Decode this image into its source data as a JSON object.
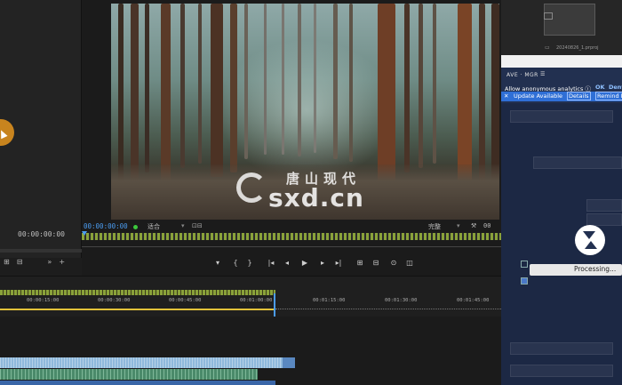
{
  "left_panel": {
    "timecode": "00:00:00:00"
  },
  "program_monitor": {
    "timecode": "00:00:00:00",
    "fit_label": "适合",
    "quality_label": "完整",
    "right_timecode": "00",
    "watermark_cn": "唐山现代",
    "watermark_en": "sxd.cn"
  },
  "transport": {
    "marker": "▾",
    "in_point": "{",
    "out_point": "}",
    "go_to_in": "|◂",
    "step_back": "◂",
    "play": "▶",
    "step_forward": "▸",
    "go_to_out": "▸|",
    "lift": "⊞",
    "extract": "⊟",
    "export_frame": "⊙",
    "comparison": "◫"
  },
  "project_panel": {
    "file_name": "20240826_1.prproj"
  },
  "ave_panel": {
    "title": "AVE · MGR",
    "menu": "☰",
    "analytics_text": "Allow anonymous analytics ⓘ",
    "ok": "OK",
    "deny": "Deny",
    "update_text": "Update Available",
    "details": "Details",
    "remind": "Remind M",
    "close": "✕",
    "processing": "Processing..."
  },
  "timeline": {
    "ruler_labels": [
      "00:00:15:00",
      "00:00:30:00",
      "00:00:45:00",
      "00:01:00:00",
      "00:01:15:00",
      "00:01:30:00",
      "00:01:45:00"
    ]
  },
  "colors": {
    "accent_blue": "#4b9cf0",
    "update_bar": "#2f6fd6",
    "ave_bg": "#223050",
    "timeline_yellow": "#e2c23a",
    "clip_blue": "#8fb9dc",
    "clip_green": "#4a8a6a"
  }
}
